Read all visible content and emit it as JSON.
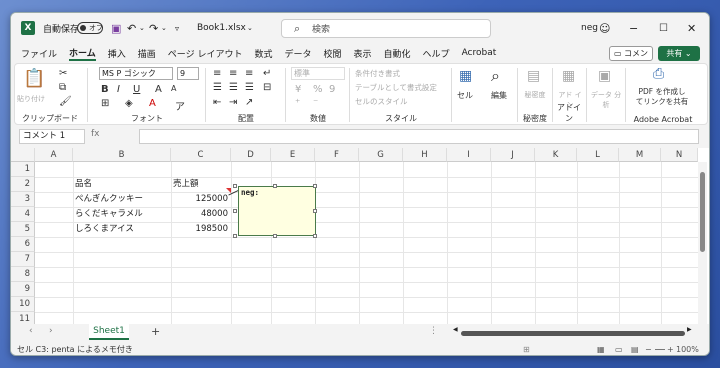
{
  "titlebar": {
    "autosave": "自動保存",
    "toggle_state": "オフ",
    "filename": "Book1.xlsx",
    "search_placeholder": "検索",
    "user": "neg"
  },
  "menu": [
    "ファイル",
    "ホーム",
    "挿入",
    "描画",
    "ページ レイアウト",
    "数式",
    "データ",
    "校閲",
    "表示",
    "自動化",
    "ヘルプ",
    "Acrobat"
  ],
  "menu_active": "ホーム",
  "actions": {
    "comment": "コメント",
    "share": "共有"
  },
  "ribbon": {
    "clipboard": {
      "paste": "貼り付け",
      "label": "クリップボード"
    },
    "font": {
      "name": "MS P ゴシック",
      "size": "9",
      "label": "フォント",
      "bold": "B",
      "italic": "I",
      "underline": "U"
    },
    "alignment": {
      "label": "配置"
    },
    "number": {
      "format": "標準",
      "label": "数値"
    },
    "style": {
      "cond": "条件付き書式",
      "table": "テーブルとして書式設定",
      "cellstyle": "セルのスタイル",
      "label": "スタイル"
    },
    "cells": {
      "label": "セル"
    },
    "editing": {
      "label": "編集"
    },
    "sensitivity": {
      "btn": "秘密度",
      "label": "秘密度"
    },
    "addin": {
      "btn": "アド イン",
      "label": "アドイン"
    },
    "analyze": {
      "btn": "データ 分析"
    },
    "acrobat": {
      "btn1": "PDF を作成し",
      "btn2": "てリンクを共有",
      "label": "Adobe Acrobat"
    }
  },
  "formula": {
    "namebox": "コメント 1",
    "fx": "fx",
    "value": ""
  },
  "columns": [
    "A",
    "B",
    "C",
    "D",
    "E",
    "F",
    "G",
    "H",
    "I",
    "J",
    "K",
    "L",
    "M",
    "N"
  ],
  "rows": [
    "1",
    "2",
    "3",
    "4",
    "5",
    "6",
    "7",
    "8",
    "9",
    "10",
    "11"
  ],
  "table": {
    "header": {
      "b": "品名",
      "c": "売上額"
    },
    "rows": [
      {
        "b": "ぺんぎんクッキー",
        "c": "125000"
      },
      {
        "b": "らくだキャラメル",
        "c": "48000"
      },
      {
        "b": "しろくまアイス",
        "c": "198500"
      }
    ]
  },
  "comment": {
    "text": "neg:"
  },
  "sheets": [
    "Sheet1"
  ],
  "status": {
    "text": "セル C3: penta によるメモ付き",
    "zoom": "100%"
  }
}
